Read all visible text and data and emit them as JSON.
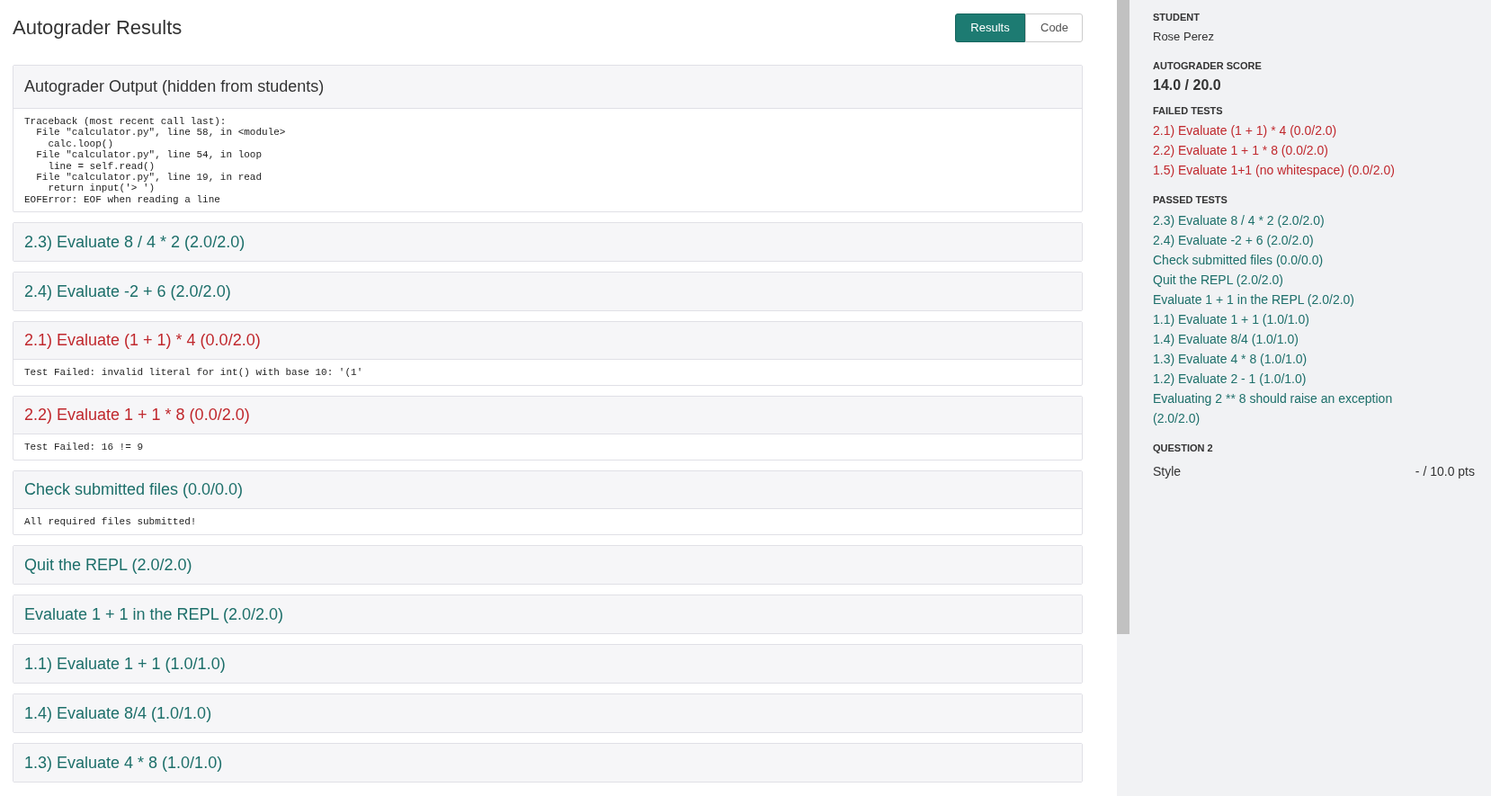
{
  "page_title": "Autograder Results",
  "view_tabs": [
    {
      "label": "Results",
      "selected": true
    },
    {
      "label": "Code",
      "selected": false
    }
  ],
  "output_panel": {
    "title": "Autograder Output (hidden from students)",
    "text": "Traceback (most recent call last):\n  File \"calculator.py\", line 58, in <module>\n    calc.loop()\n  File \"calculator.py\", line 54, in loop\n    line = self.read()\n  File \"calculator.py\", line 19, in read\n    return input('> ')\nEOFError: EOF when reading a line"
  },
  "tests": [
    {
      "title": "2.3) Evaluate 8 / 4 * 2 (2.0/2.0)",
      "failed": false
    },
    {
      "title": "2.4) Evaluate -2 + 6 (2.0/2.0)",
      "failed": false
    },
    {
      "title": "2.1) Evaluate (1 + 1) * 4 (0.0/2.0)",
      "failed": true,
      "output": "Test Failed: invalid literal for int() with base 10: '(1'"
    },
    {
      "title": "2.2) Evaluate 1 + 1 * 8 (0.0/2.0)",
      "failed": true,
      "output": "Test Failed: 16 != 9"
    },
    {
      "title": "Check submitted files (0.0/0.0)",
      "failed": false,
      "output": "All required files submitted!"
    },
    {
      "title": "Quit the REPL (2.0/2.0)",
      "failed": false
    },
    {
      "title": "Evaluate 1 + 1 in the REPL (2.0/2.0)",
      "failed": false
    },
    {
      "title": "1.1) Evaluate 1 + 1 (1.0/1.0)",
      "failed": false
    },
    {
      "title": "1.4) Evaluate 8/4 (1.0/1.0)",
      "failed": false
    },
    {
      "title": "1.3) Evaluate 4 * 8 (1.0/1.0)",
      "failed": false
    }
  ],
  "sidebar": {
    "student_label": "STUDENT",
    "student_name": "Rose Perez",
    "score_label": "AUTOGRADER SCORE",
    "score": "14.0 / 20.0",
    "failed_label": "FAILED TESTS",
    "failed_tests": [
      "2.1) Evaluate (1 + 1) * 4 (0.0/2.0)",
      "2.2) Evaluate 1 + 1 * 8 (0.0/2.0)",
      "1.5) Evaluate 1+1 (no whitespace) (0.0/2.0)"
    ],
    "passed_label": "PASSED TESTS",
    "passed_tests": [
      "2.3) Evaluate 8 / 4 * 2 (2.0/2.0)",
      "2.4) Evaluate -2 + 6 (2.0/2.0)",
      "Check submitted files (0.0/0.0)",
      "Quit the REPL (2.0/2.0)",
      "Evaluate 1 + 1 in the REPL (2.0/2.0)",
      "1.1) Evaluate 1 + 1 (1.0/1.0)",
      "1.4) Evaluate 8/4 (1.0/1.0)",
      "1.3) Evaluate 4 * 8 (1.0/1.0)",
      "1.2) Evaluate 2 - 1 (1.0/1.0)",
      "Evaluating 2 ** 8 should raise an exception (2.0/2.0)"
    ],
    "question_label": "QUESTION 2",
    "question_item": "Style",
    "question_points": "- / 10.0 pts"
  }
}
